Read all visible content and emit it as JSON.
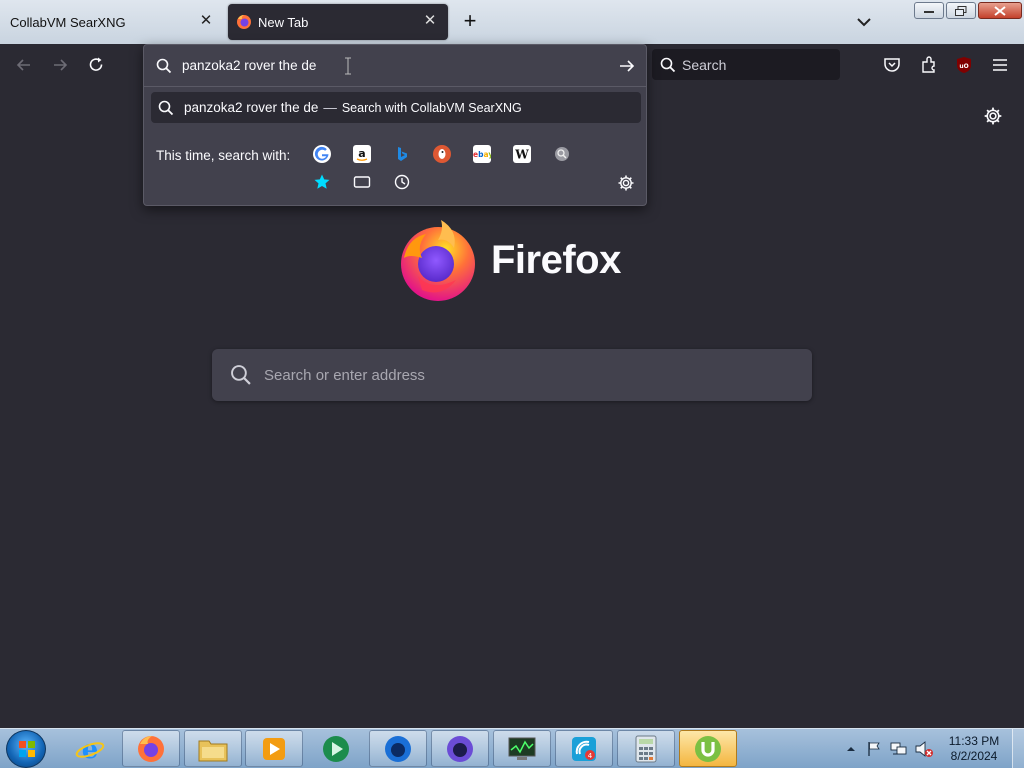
{
  "tabs": [
    {
      "label": "CollabVM SearXNG",
      "active": false
    },
    {
      "label": "New Tab",
      "active": true
    }
  ],
  "toolbar": {
    "search_placeholder": "Search"
  },
  "urlbar": {
    "value": "panzoka2 rover the de",
    "suggestion_query": "panzoka2 rover the de",
    "suggestion_separator": "—",
    "suggestion_action": "Search with CollabVM SearXNG",
    "oneoff_label": "This time, search with:",
    "oneoff_engines": [
      "google-icon",
      "amazon-icon",
      "bing-icon",
      "duckduckgo-icon",
      "ebay-icon",
      "wikipedia-icon",
      "searxng-icon"
    ],
    "oneoff_modes": [
      "bookmarks-icon",
      "tabs-icon",
      "history-icon"
    ]
  },
  "newtab": {
    "wordmark": "Firefox",
    "search_placeholder": "Search or enter address"
  },
  "taskbar": {
    "apps": [
      "internet-explorer-icon",
      "firefox-icon",
      "file-explorer-icon",
      "media-player-icon",
      "media-center-icon",
      "firefox-dev-icon",
      "firefox-nightly-icon",
      "task-manager-icon",
      "network-app-icon",
      "calculator-icon",
      "utorrent-icon"
    ],
    "clock_time": "11:33 PM",
    "clock_date": "8/2/2024"
  },
  "colors": {
    "page_bg": "#2b2a33",
    "popup_bg": "#42414d",
    "accent_firefox": "#ff7139"
  }
}
